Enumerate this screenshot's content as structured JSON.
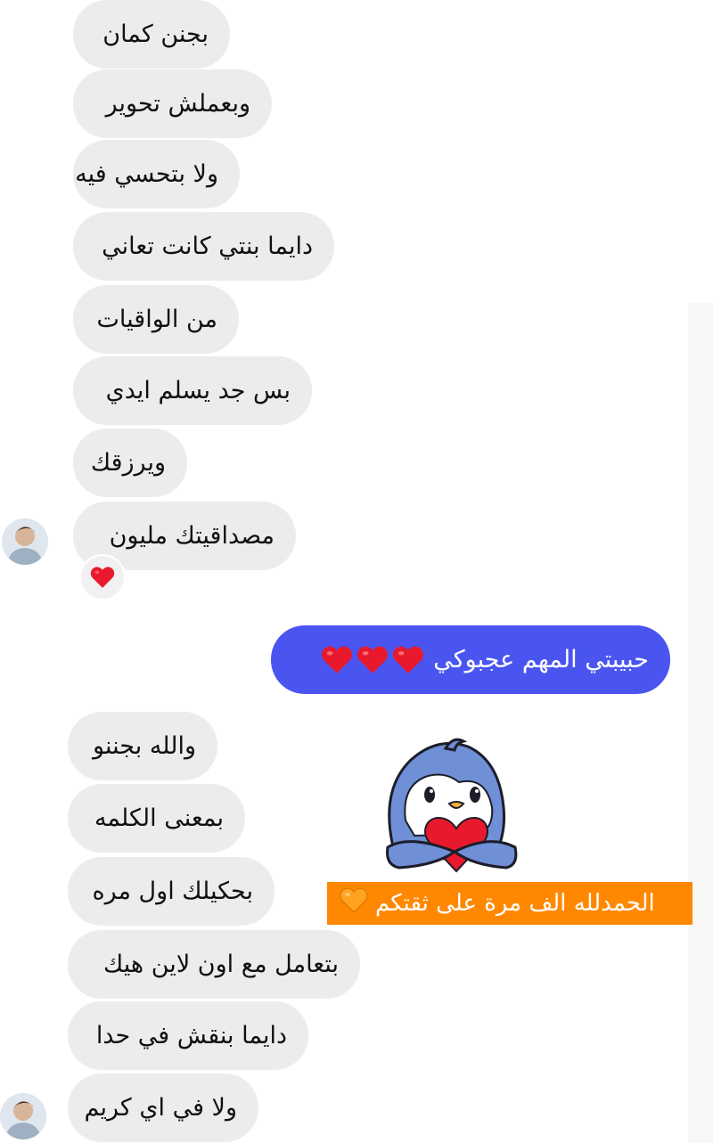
{
  "messages_top": [
    {
      "text": "بجنن كمان"
    },
    {
      "text": "وبعملش تحوير"
    },
    {
      "text": "ولا بتحسي فيه"
    },
    {
      "text": "دايما بنتي كانت تعاني"
    },
    {
      "text": "من الواقيات"
    },
    {
      "text": "بس جد يسلم ايدي"
    },
    {
      "text": "ويرزقك"
    },
    {
      "text": "مصداقيتك مليون"
    }
  ],
  "reaction": {
    "icon": "red-heart-icon",
    "color": "#e8192c"
  },
  "outgoing": {
    "text": "حبيبتي المهم عجبوكي",
    "hearts": 3,
    "bubble_color": "#4a55f0"
  },
  "messages_bottom": [
    {
      "text": "والله بجننو"
    },
    {
      "text": "بمعنى الكلمه"
    },
    {
      "text": "بحكيلك اول مره"
    },
    {
      "text": "بتعامل مع اون لاين هيك"
    },
    {
      "text": "دايما بنقش في حدا"
    },
    {
      "text": "ولا في اي كريم"
    }
  ],
  "overlay": {
    "sticker": "penguin-holding-heart-sticker",
    "banner_text": "الحمدلله الف مرة على ثقتكم",
    "banner_color": "#ff8800",
    "banner_icon": "orange-heart-icon"
  }
}
